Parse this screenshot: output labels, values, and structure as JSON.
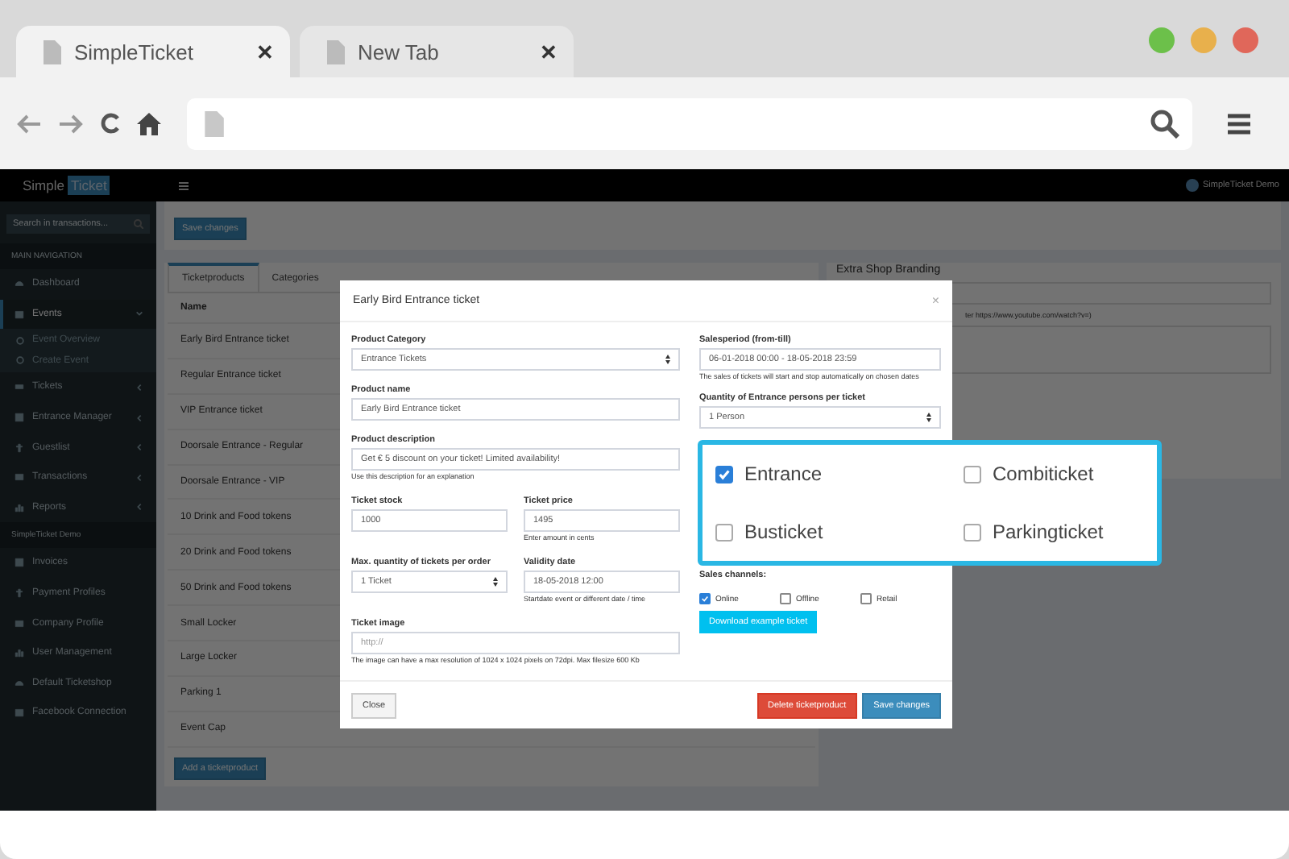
{
  "browser": {
    "tabs": [
      {
        "title": "SimpleTicket",
        "selected": true,
        "close": "✕"
      },
      {
        "title": "New Tab",
        "selected": false,
        "close": "✕"
      }
    ]
  },
  "header": {
    "logo": [
      "Simple",
      "Ticket"
    ],
    "user": "SimpleTicket Demo"
  },
  "sidebar": {
    "search_placeholder": "Search in transactions...",
    "sections": [
      {
        "heading": "MAIN NAVIGATION",
        "items": [
          {
            "label": "Dashboard",
            "kind": "link",
            "selected": false
          },
          {
            "label": "Events",
            "kind": "group",
            "selected": true,
            "expanded": true,
            "children": [
              {
                "label": "Event Overview"
              },
              {
                "label": "Create Event"
              }
            ]
          },
          {
            "label": "Tickets",
            "kind": "group",
            "selected": false,
            "expanded": false
          },
          {
            "label": "Entrance Manager",
            "kind": "group",
            "selected": false,
            "expanded": false
          },
          {
            "label": "Guestlist",
            "kind": "group",
            "selected": false,
            "expanded": false
          },
          {
            "label": "Transactions",
            "kind": "group",
            "selected": false,
            "expanded": false
          },
          {
            "label": "Reports",
            "kind": "group",
            "selected": false,
            "expanded": false
          }
        ]
      },
      {
        "heading": "SimpleTicket Demo",
        "items": [
          {
            "label": "Invoices",
            "kind": "link",
            "selected": false
          },
          {
            "label": "Payment Profiles",
            "kind": "link",
            "selected": false
          },
          {
            "label": "Company Profile",
            "kind": "link",
            "selected": false
          },
          {
            "label": "User Management",
            "kind": "link",
            "selected": false
          },
          {
            "label": "Default Ticketshop",
            "kind": "link",
            "selected": false
          },
          {
            "label": "Facebook Connection",
            "kind": "link",
            "selected": false
          }
        ]
      }
    ]
  },
  "page": {
    "save_button": "Save changes",
    "tabs": [
      {
        "label": "Ticketproducts",
        "selected": true
      },
      {
        "label": "Categories",
        "selected": false
      }
    ],
    "table": {
      "columns": [
        "Name"
      ],
      "rows": [
        "Early Bird Entrance ticket",
        "Regular Entrance ticket",
        "VIP Entrance ticket",
        "Doorsale Entrance - Regular",
        "Doorsale Entrance - VIP",
        "10 Drink and Food tokens",
        "20 Drink and Food tokens",
        "50 Drink and Food tokens",
        "Small Locker",
        "Large Locker",
        "Parking 1",
        "Event Cap"
      ]
    },
    "add_button": "Add a ticketproduct",
    "branding": {
      "title": "Extra Shop Branding",
      "hint": "ter https://www.youtube.com/watch?v=)"
    }
  },
  "modal": {
    "title": "Early Bird Entrance ticket",
    "close": "×",
    "left": [
      {
        "fields": [
          {
            "label": "Product Category",
            "kind": "select",
            "value": "Entrance Tickets"
          }
        ]
      },
      {
        "fields": [
          {
            "label": "Product name",
            "kind": "input",
            "value": "Early Bird Entrance ticket"
          }
        ]
      },
      {
        "fields": [
          {
            "label": "Product description",
            "kind": "input",
            "value": "Get € 5 discount on your ticket! Limited availability!",
            "help": "Use this description for an explanation"
          }
        ]
      },
      {
        "fields": [
          {
            "label": "Ticket stock",
            "kind": "input",
            "value": "1000"
          },
          {
            "label": "Ticket price",
            "kind": "input",
            "value": "1495",
            "help": "Enter amount in cents"
          }
        ]
      },
      {
        "fields": [
          {
            "label": "Max. quantity of tickets per order",
            "kind": "select",
            "value": "1 Ticket"
          },
          {
            "label": "Validity date",
            "kind": "input",
            "value": "18-05-2018 12:00",
            "help": "Startdate event or different date / time"
          }
        ]
      },
      {
        "fields": [
          {
            "label": "Ticket image",
            "kind": "input",
            "placeholder": "http://",
            "help": "The image can have a max resolution of 1024 x 1024 pixels on 72dpi. Max filesize 600 Kb"
          }
        ]
      }
    ],
    "right": [
      {
        "label": "Salesperiod (from-till)",
        "kind": "input",
        "value": "06-01-2018 00:00 - 18-05-2018 23:59",
        "help": "The sales of tickets will start and stop automatically on chosen dates"
      },
      {
        "label": "Quantity of Entrance persons per ticket",
        "kind": "select",
        "value": "1 Person"
      }
    ],
    "ticket_types": [
      {
        "label": "Entrance",
        "checked": true
      },
      {
        "label": "Combiticket",
        "checked": false
      },
      {
        "label": "Busticket",
        "checked": false
      },
      {
        "label": "Parkingticket",
        "checked": false
      }
    ],
    "sales_channels": {
      "label": "Sales channels:",
      "options": [
        {
          "label": "Online",
          "checked": true
        },
        {
          "label": "Offline",
          "checked": false
        },
        {
          "label": "Retail",
          "checked": false
        }
      ]
    },
    "download_button": "Download example ticket",
    "buttons": [
      {
        "label": "Close",
        "kind": "default"
      },
      {
        "label": "Delete ticketproduct",
        "kind": "danger"
      },
      {
        "label": "Save changes",
        "kind": "primary"
      }
    ]
  }
}
